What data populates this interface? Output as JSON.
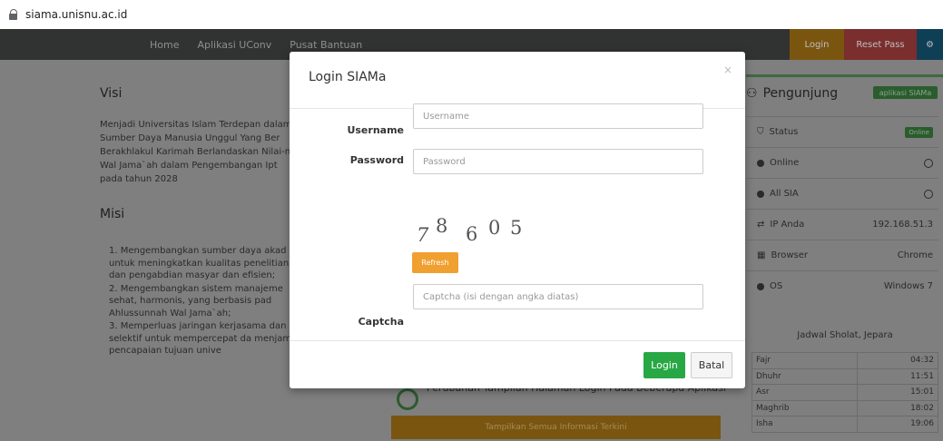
{
  "browser": {
    "url": "siama.unisnu.ac.id",
    "lock_icon": "lock-icon"
  },
  "navbar": {
    "links": [
      "Home",
      "Aplikasi UConv",
      "Pusat Bantuan"
    ],
    "login_label": "Login",
    "reset_label": "Reset Pass",
    "gear_icon": "gear-icon"
  },
  "visi": {
    "title": "Visi",
    "text": "Menjadi Universitas Islam Terdepan dalam Sumber Daya Manusia Unggul Yang Ber Berakhlakul Karimah Berlandaskan Nilai-n Wal Jama`ah dalam Pengembangan Ipt pada tahun 2028"
  },
  "misi": {
    "title": "Misi",
    "items": [
      "1. Mengembangkan sumber daya akad untuk meningkatkan kualitas penelitian, dan pengabdian masyar dan efisien;",
      "2. Mengembangkan sistem manajeme sehat, harmonis, yang berbasis pad Ahlussunnah Wal Jama`ah;",
      "3. Memperluas jaringan kerjasama dan selektif untuk mempercepat da menjamin pencapaian tujuan unive"
    ]
  },
  "pengunjung": {
    "title": "Pengunjung",
    "badge": "aplikasi SIAMa",
    "rows": [
      {
        "label": "Status",
        "value": "Online"
      },
      {
        "label": "Online",
        "value": ""
      },
      {
        "label": "All SIA",
        "value": ""
      },
      {
        "label": "IP Anda",
        "value": "192.168.51.3"
      },
      {
        "label": "Browser",
        "value": "Chrome"
      },
      {
        "label": "OS",
        "value": "Windows 7"
      }
    ]
  },
  "jadwal": {
    "title": "Jadwal Sholat, Jepara",
    "rows": [
      {
        "name": "Fajr",
        "time": "04:32"
      },
      {
        "name": "Dhuhr",
        "time": "11:51"
      },
      {
        "name": "Asr",
        "time": "15:01"
      },
      {
        "name": "Maghrib",
        "time": "18:02"
      },
      {
        "name": "Isha",
        "time": "19:06"
      }
    ]
  },
  "news": {
    "headline": "Perubahan Tampilan Halaman Login Pada Beberapa Aplikasi",
    "button": "Tampilkan Semua Informasi Terkini"
  },
  "modal": {
    "title": "Login SIAMa",
    "close": "×",
    "username_label": "Username",
    "username_placeholder": "Username",
    "username_value": "",
    "password_label": "Password",
    "password_placeholder": "Password",
    "password_value": "",
    "captcha_digits": [
      "7",
      "8",
      "6",
      "0",
      "5"
    ],
    "refresh_label": "Refresh",
    "captcha_label": "Captcha",
    "captcha_placeholder": "Captcha (isi dengan angka diatas)",
    "captcha_value": "",
    "login_label": "Login",
    "batal_label": "Batal"
  },
  "colors": {
    "login_green": "#28a745",
    "refresh_orange": "#f0a030",
    "overlay": "#7f7f7f"
  }
}
